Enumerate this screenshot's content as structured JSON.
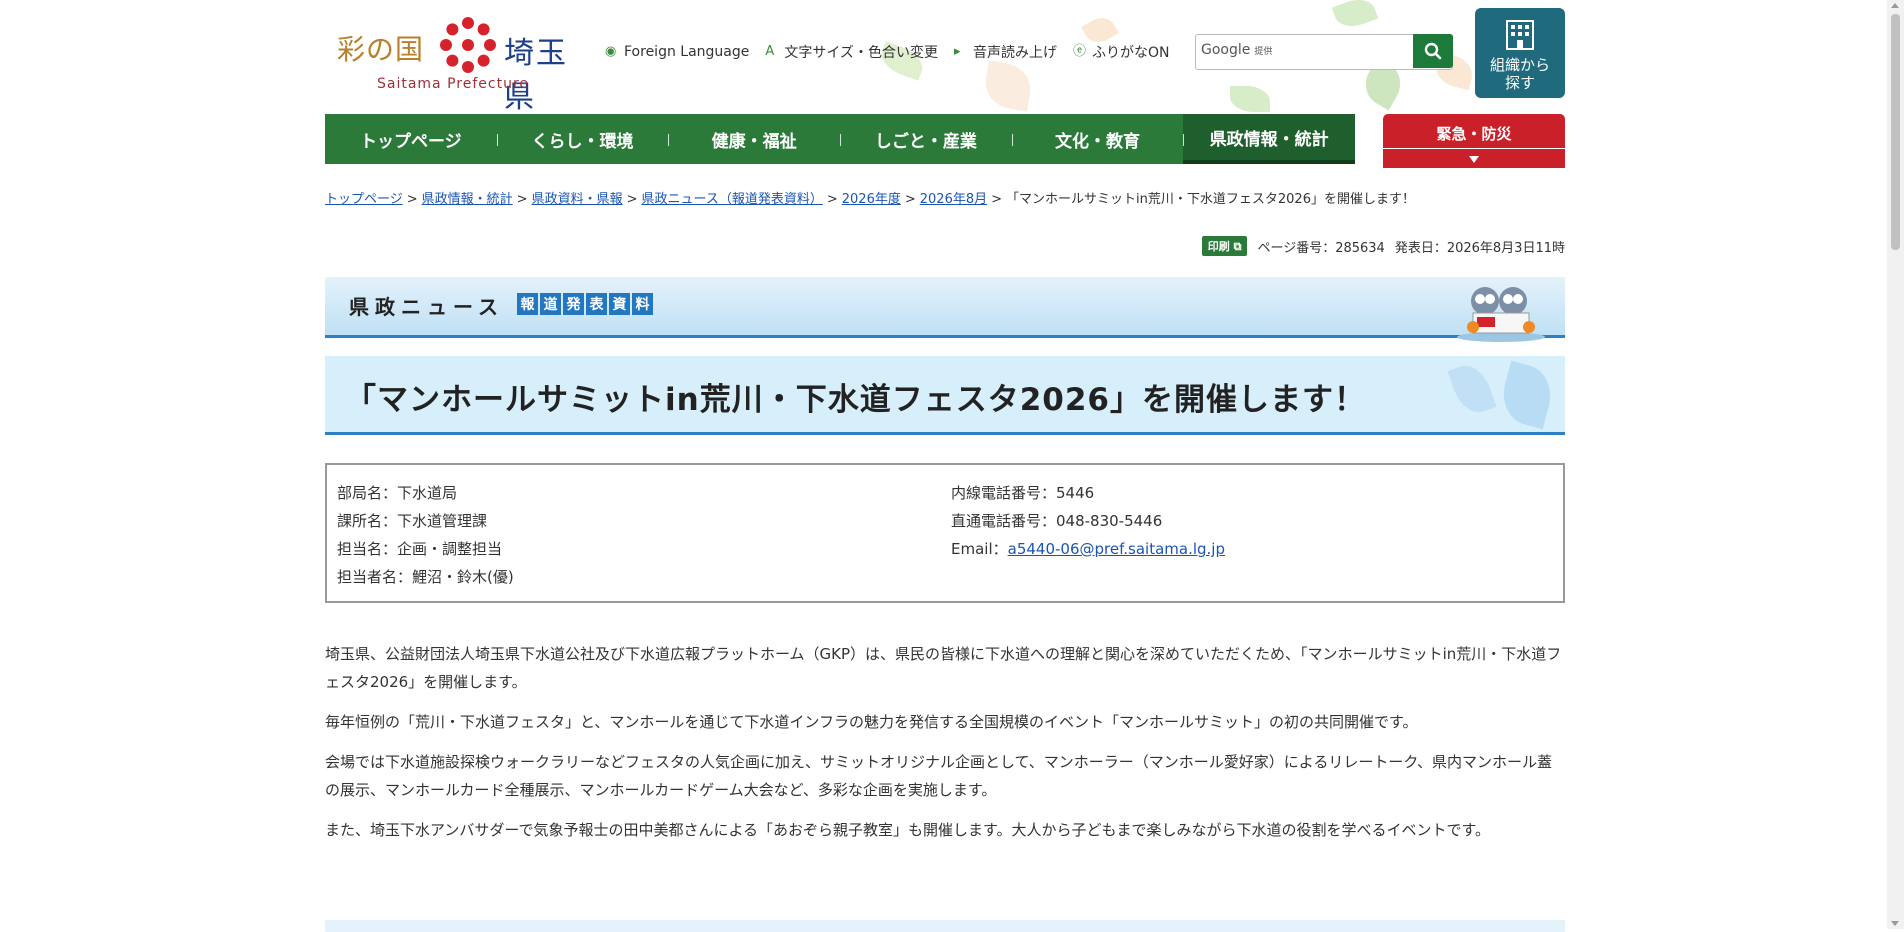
{
  "header": {
    "logo_jp_left": "彩の国",
    "logo_jp_right": "埼玉県",
    "logo_en": "Saitama Prefecture",
    "utilities": [
      {
        "label": "Foreign Language",
        "icon": "globe-icon"
      },
      {
        "label": "文字サイズ・色合い変更",
        "icon": "text-size-icon"
      },
      {
        "label": "音声読み上げ",
        "icon": "speaker-icon"
      },
      {
        "label": "ふりがなON",
        "icon": "furigana-icon"
      }
    ],
    "search": {
      "brand": "Google",
      "brand_suffix": "提供",
      "value": ""
    },
    "org_button": "組織から探す"
  },
  "nav": {
    "items": [
      "トップページ",
      "くらし・環境",
      "健康・福祉",
      "しごと・産業",
      "文化・教育",
      "県政情報・統計"
    ],
    "active": "県政情報・統計",
    "emergency": "緊急・防災"
  },
  "breadcrumb": {
    "links": [
      "トップページ",
      "県政情報・統計",
      "県政資料・県報",
      "県政ニュース（報道発表資料）",
      "2026年度",
      "2026年8月"
    ],
    "current": "「マンホールサミットin荒川・下水道フェスタ2026」を開催します！"
  },
  "meta": {
    "print_label": "印刷",
    "page_number": "ページ番号：285634",
    "published": "発表日：2026年8月3日11時"
  },
  "banner": {
    "title": "県政ニュース",
    "tags": [
      "報",
      "道",
      "発",
      "表",
      "資",
      "料"
    ]
  },
  "article": {
    "title": "「マンホールサミットin荒川・下水道フェスタ2026」を開催します！",
    "info_left": [
      "部局名：下水道局",
      "課所名：下水道管理課",
      "担当名：企画・調整担当",
      "担当者名：鯉沼・鈴木(優)"
    ],
    "info_right": [
      "内線電話番号：5446",
      "直通電話番号：048-830-5446"
    ],
    "email_label": "Email：",
    "email": "a5440-06@pref.saitama.lg.jp",
    "paragraphs": [
      "埼玉県、公益財団法人埼玉県下水道公社及び下水道広報プラットホーム（GKP）は、県民の皆様に下水道への理解と関心を深めていただくため、「マンホールサミットin荒川・下水道フェスタ2026」を開催します。",
      "毎年恒例の「荒川・下水道フェスタ」と、マンホールを通じて下水道インフラの魅力を発信する全国規模のイベント「マンホールサミット」の初の共同開催です。",
      "会場では下水道施設探検ウォークラリーなどフェスタの人気企画に加え、サミットオリジナル企画として、マンホーラー（マンホール愛好家）によるリレートーク、県内マンホール蓋の展示、マンホールカード全種展示、マンホールカードゲーム大会など、多彩な企画を実施します。",
      "また、埼玉下水アンバサダーで気象予報士の田中美都さんによる「あおぞら親子教室」も開催します。大人から子どもまで楽しみながら下水道の役割を学べるイベントです。"
    ]
  },
  "colors": {
    "nav_green": "#2b7a3a",
    "emergency_red": "#c9202a",
    "org_teal": "#1f6a7d",
    "heading_blue": "#2c7fc3"
  }
}
